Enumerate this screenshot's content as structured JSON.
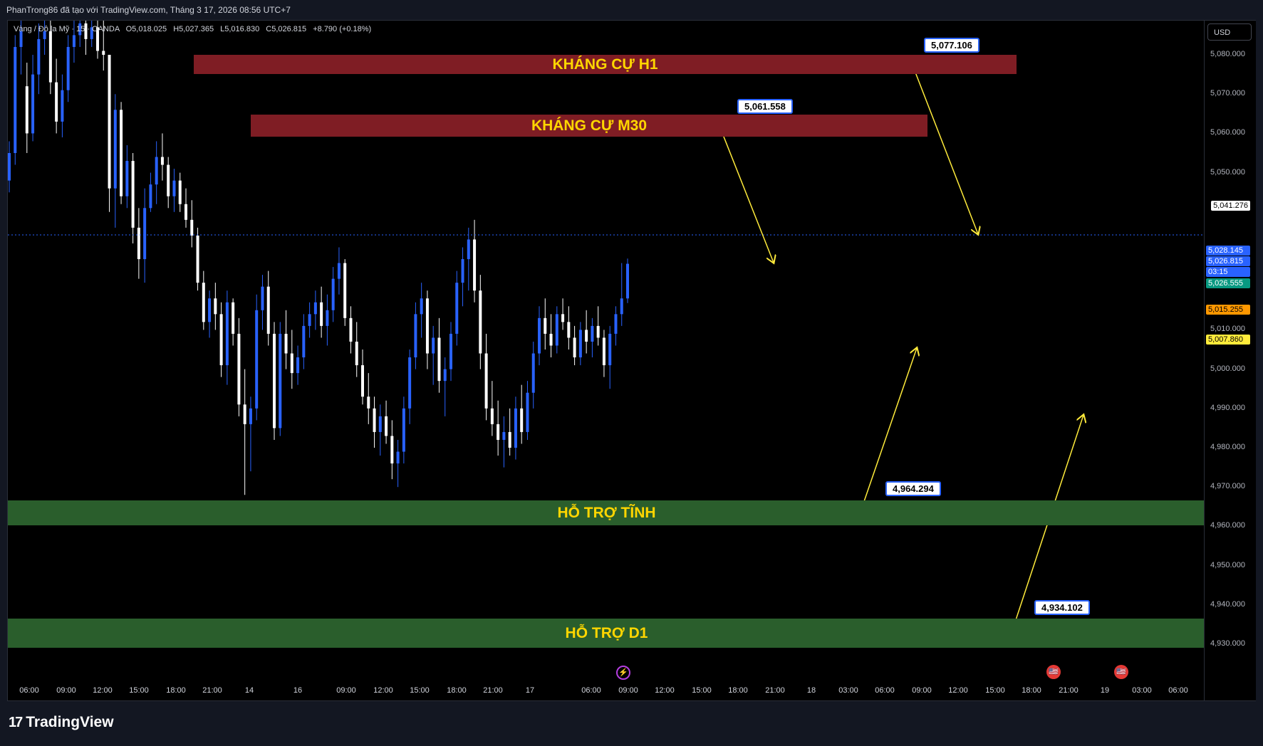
{
  "header": {
    "title": "PhanTrong86 đã tạo với TradingView.com, Tháng 3 17, 2026 08:56 UTC+7"
  },
  "legend": {
    "symbol": "Vàng / Đô la Mỹ · 15 · OANDA",
    "o": "O5,018.025",
    "h": "H5,027.365",
    "l": "L5,016.830",
    "c": "C5,026.815",
    "change": "+8.790 (+0.18%)"
  },
  "currency_button": "USD",
  "zones": {
    "resistance_h1": "KHÁNG CỰ H1",
    "resistance_m30": "KHÁNG CỰ M30",
    "support_static": "HỖ TRỢ TĨNH",
    "support_d1": "HỖ TRỢ D1"
  },
  "callouts": {
    "h1": "5,077.106",
    "m30": "5,061.558",
    "static": "4,964.294",
    "d1": "4,934.102"
  },
  "price_scale": {
    "ticks": [
      "5,080.000",
      "5,070.000",
      "5,060.000",
      "5,050.000",
      "5,010.000",
      "5,000.000",
      "4,990.000",
      "4,980.000",
      "4,970.000",
      "4,960.000",
      "4,950.000",
      "4,940.000",
      "4,930.000"
    ],
    "labels": {
      "ma_white": "5,041.276",
      "high": "5,028.145",
      "last": "5,026.815",
      "countdown": "03:15",
      "green": "5,026.555",
      "orange": "5,015.255",
      "yellow": "5,007.860"
    }
  },
  "time_axis": [
    "06:00",
    "09:00",
    "12:00",
    "15:00",
    "18:00",
    "21:00",
    "14",
    "16",
    "09:00",
    "12:00",
    "15:00",
    "18:00",
    "21:00",
    "17",
    "06:00",
    "09:00",
    "12:00",
    "15:00",
    "18:00",
    "21:00",
    "18",
    "03:00",
    "06:00",
    "09:00",
    "12:00",
    "15:00",
    "18:00",
    "21:00",
    "19",
    "03:00",
    "06:00"
  ],
  "brand": "TradingView",
  "colors": {
    "background": "#000000",
    "candle_up": "#2962ff",
    "candle_down": "#ffffff",
    "resistance_zone": "#7f1d24",
    "support_zone": "#2a5e2c",
    "zone_text": "#ffd600",
    "arrow": "#ffeb3b"
  },
  "icons": [
    "flash-icon",
    "us-flag-icon"
  ],
  "chart_data": {
    "type": "candlestick",
    "symbol": "Vàng / Đô la Mỹ",
    "timeframe": "15",
    "ylim": [
      4925,
      5090
    ],
    "zones": [
      {
        "label": "KHÁNG CỰ H1",
        "low": 5074.3,
        "high": 5079.2,
        "marker": 5077.106
      },
      {
        "label": "KHÁNG CỰ M30",
        "low": 5058.6,
        "high": 5064.3,
        "marker": 5061.558
      },
      {
        "label": "HỖ TRỢ TĨNH",
        "low": 4960.8,
        "high": 4967.1,
        "marker": 4964.294
      },
      {
        "label": "HỖ TRỢ D1",
        "low": 4929.8,
        "high": 4937.2,
        "marker": 4934.102
      }
    ],
    "candles": [
      [
        5048,
        5058,
        5045,
        5055
      ],
      [
        5055,
        5085,
        5052,
        5082
      ],
      [
        5082,
        5090,
        5075,
        5086
      ],
      [
        5072,
        5078,
        5055,
        5060
      ],
      [
        5060,
        5080,
        5058,
        5075
      ],
      [
        5075,
        5088,
        5070,
        5084
      ],
      [
        5084,
        5090,
        5080,
        5086
      ],
      [
        5086,
        5089,
        5070,
        5073
      ],
      [
        5073,
        5079,
        5060,
        5063
      ],
      [
        5063,
        5075,
        5059,
        5071
      ],
      [
        5071,
        5085,
        5068,
        5082
      ],
      [
        5082,
        5090,
        5078,
        5085
      ],
      [
        5085,
        5090,
        5082,
        5088
      ],
      [
        5088,
        5090,
        5080,
        5084
      ],
      [
        5084,
        5090,
        5082,
        5087
      ],
      [
        5087,
        5090,
        5079,
        5081
      ],
      [
        5081,
        5090,
        5076,
        5080
      ],
      [
        5080,
        5070,
        5040,
        5046
      ],
      [
        5046,
        5070,
        5036,
        5066
      ],
      [
        5066,
        5068,
        5042,
        5044
      ],
      [
        5044,
        5057,
        5041,
        5053
      ],
      [
        5053,
        5055,
        5032,
        5036
      ],
      [
        5036,
        5041,
        5023,
        5028
      ],
      [
        5028,
        5046,
        5022,
        5041
      ],
      [
        5041,
        5050,
        5040,
        5047
      ],
      [
        5047,
        5058,
        5042,
        5054
      ],
      [
        5054,
        5060,
        5048,
        5052
      ],
      [
        5052,
        5054,
        5041,
        5044
      ],
      [
        5044,
        5051,
        5040,
        5048
      ],
      [
        5048,
        5050,
        5040,
        5042
      ],
      [
        5042,
        5046,
        5036,
        5038
      ],
      [
        5038,
        5043,
        5031,
        5034
      ],
      [
        5034,
        5036,
        5020,
        5022
      ],
      [
        5022,
        5025,
        5010,
        5012
      ],
      [
        5012,
        5020,
        5008,
        5018
      ],
      [
        5018,
        5022,
        5010,
        5014
      ],
      [
        5014,
        5017,
        4998,
        5001
      ],
      [
        5001,
        5020,
        4996,
        5017
      ],
      [
        5017,
        5018,
        5006,
        5009
      ],
      [
        5009,
        5013,
        4988,
        4991
      ],
      [
        4991,
        5000,
        4968,
        4986
      ],
      [
        4986,
        4993,
        4974,
        4990
      ],
      [
        4990,
        5019,
        4987,
        5015
      ],
      [
        5015,
        5024,
        5010,
        5021
      ],
      [
        5021,
        5025,
        5006,
        5009
      ],
      [
        5009,
        5012,
        4982,
        4985
      ],
      [
        4985,
        5012,
        4983,
        5009
      ],
      [
        5009,
        5015,
        5000,
        5004
      ],
      [
        5004,
        5010,
        4995,
        4999
      ],
      [
        4999,
        5006,
        4996,
        5003
      ],
      [
        5003,
        5014,
        5000,
        5011
      ],
      [
        5011,
        5017,
        5008,
        5014
      ],
      [
        5014,
        5020,
        5010,
        5017
      ],
      [
        5017,
        5021,
        5008,
        5011
      ],
      [
        5011,
        5019,
        5006,
        5015
      ],
      [
        5015,
        5026,
        5012,
        5023
      ],
      [
        5023,
        5031,
        5019,
        5027
      ],
      [
        5027,
        5028,
        5011,
        5013
      ],
      [
        5013,
        5016,
        5004,
        5007
      ],
      [
        5007,
        5012,
        4998,
        5001
      ],
      [
        5001,
        5005,
        4991,
        4993
      ],
      [
        4993,
        4999,
        4986,
        4990
      ],
      [
        4990,
        4993,
        4980,
        4984
      ],
      [
        4984,
        4991,
        4978,
        4988
      ],
      [
        4988,
        4992,
        4981,
        4983
      ],
      [
        4983,
        4987,
        4972,
        4976
      ],
      [
        4976,
        4982,
        4970,
        4979
      ],
      [
        4979,
        4993,
        4976,
        4990
      ],
      [
        4990,
        5005,
        4986,
        5003
      ],
      [
        5003,
        5017,
        5000,
        5014
      ],
      [
        5014,
        5022,
        5008,
        5018
      ],
      [
        5018,
        5020,
        5000,
        5004
      ],
      [
        5004,
        5011,
        4996,
        5008
      ],
      [
        5008,
        5013,
        4994,
        4997
      ],
      [
        4997,
        5003,
        4988,
        5000
      ],
      [
        5000,
        5012,
        4997,
        5009
      ],
      [
        5009,
        5025,
        5006,
        5022
      ],
      [
        5022,
        5031,
        5016,
        5028
      ],
      [
        5028,
        5036,
        5020,
        5033
      ],
      [
        5033,
        5038,
        5017,
        5020
      ],
      [
        5020,
        5024,
        5000,
        5004
      ],
      [
        5004,
        5009,
        4987,
        4990
      ],
      [
        4990,
        4997,
        4983,
        4986
      ],
      [
        4986,
        4992,
        4978,
        4982
      ],
      [
        4982,
        4988,
        4975,
        4984
      ],
      [
        4984,
        4990,
        4978,
        4980
      ],
      [
        4980,
        4993,
        4977,
        4990
      ],
      [
        4990,
        4996,
        4981,
        4984
      ],
      [
        4984,
        4997,
        4982,
        4994
      ],
      [
        4994,
        5007,
        4990,
        5004
      ],
      [
        5004,
        5016,
        5001,
        5013
      ],
      [
        5013,
        5018,
        5005,
        5009
      ],
      [
        5009,
        5014,
        5003,
        5006
      ],
      [
        5006,
        5016,
        5004,
        5014
      ],
      [
        5014,
        5018,
        5010,
        5012
      ],
      [
        5012,
        5016,
        5005,
        5008
      ],
      [
        5008,
        5011,
        5001,
        5003
      ],
      [
        5003,
        5012,
        5001,
        5010
      ],
      [
        5010,
        5015,
        5004,
        5007
      ],
      [
        5007,
        5013,
        5003,
        5011
      ],
      [
        5011,
        5016,
        5006,
        5008
      ],
      [
        5008,
        5010,
        4998,
        5001
      ],
      [
        5001,
        5011,
        4995,
        5009
      ],
      [
        5009,
        5016,
        5006,
        5014
      ],
      [
        5014,
        5027,
        5011,
        5018
      ],
      [
        5018,
        5028.145,
        5016.83,
        5026.815
      ]
    ],
    "last_price": 5026.815,
    "arrows": [
      {
        "from": [
          5058,
          "21:00 (16)"
        ],
        "to": [
          5027,
          "06:00 (17)"
        ],
        "direction": "down"
      },
      {
        "from": [
          5075,
          "12:00 (17)"
        ],
        "to": [
          5041,
          "18:00 (17)"
        ],
        "direction": "down"
      },
      {
        "from": [
          4963,
          "06:00 (18)"
        ],
        "to": [
          5007,
          "09:00 (18)"
        ],
        "direction": "up"
      },
      {
        "from": [
          4933,
          "18:00 (18)"
        ],
        "to": [
          4989,
          "00:00 (19)"
        ],
        "direction": "up"
      }
    ]
  }
}
